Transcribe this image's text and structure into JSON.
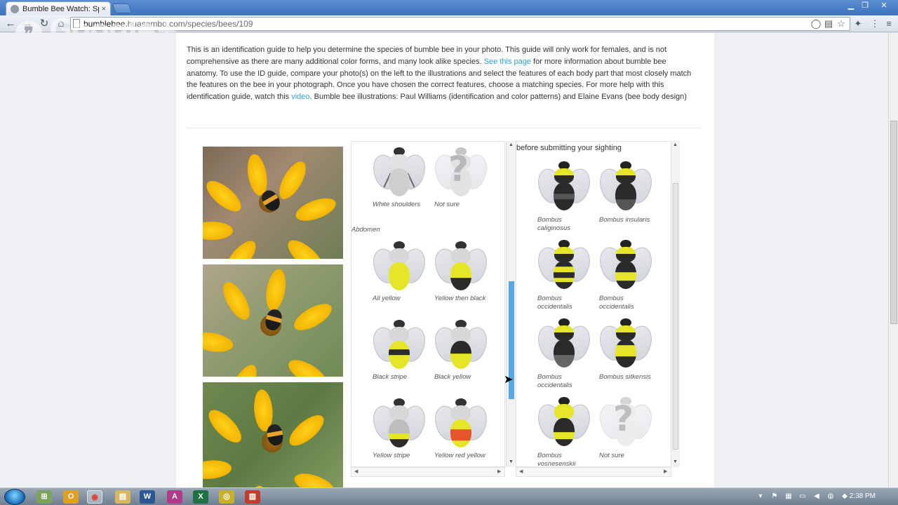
{
  "browser": {
    "tab_title": "Bumble Bee Watch: Specie",
    "tab_close": "×",
    "url_host": "bumblebee.",
    "url_host_hidden": "huasambo.com",
    "url_path": "/species/bees/109"
  },
  "overlay": {
    "gplus_text": "Google+",
    "gplus_bubble": "❞"
  },
  "intro": {
    "text_1": "This is an identification guide to help you determine the species of bumble bee in your photo. This guide will only work for females, and is not comprehensive as there are many additional color forms, and many look alike species. ",
    "link_1": "See this page",
    "text_2": " for more information about bumble bee anatomy. To use the ID guide, compare your photo(s) on the left to the illustrations and select the features of each body part that most closely match the features on the bee in your photograph. Once you have chosen the correct features, choose a matching species. For more help with this identification guide, watch this ",
    "link_2": "video",
    "text_3": ". Bumble bee illustrations: Paul Williams (identification and color patterns) and Elaine Evans (bee body design)"
  },
  "features": {
    "thorax_options": [
      {
        "label": "White shoulders"
      },
      {
        "label": "Not sure"
      }
    ],
    "abdomen_title": "Abdomen",
    "abdomen_options": [
      {
        "label": "All yellow"
      },
      {
        "label": "Yellow then black"
      },
      {
        "label": "Black stripe"
      },
      {
        "label": "Black yellow"
      },
      {
        "label": "Yellow stripe"
      },
      {
        "label": "Yellow red yellow"
      }
    ]
  },
  "species": {
    "note": "before submitting your sighting",
    "items": [
      {
        "label": "Bombus caliginosus"
      },
      {
        "label": "Bombus insularis"
      },
      {
        "label": "Bombus occidentalis"
      },
      {
        "label": "Bombus occidentalis"
      },
      {
        "label": "Bombus occidentalis"
      },
      {
        "label": "Bombus sitkensis"
      },
      {
        "label": "Bombus vosnesenskii"
      },
      {
        "label": "Not sure"
      }
    ]
  },
  "taskbar": {
    "clock": "2:38 PM",
    "apps": [
      "⊞",
      "O",
      "◉",
      "▤",
      "W",
      "A",
      "X",
      "◎",
      "▨"
    ]
  }
}
